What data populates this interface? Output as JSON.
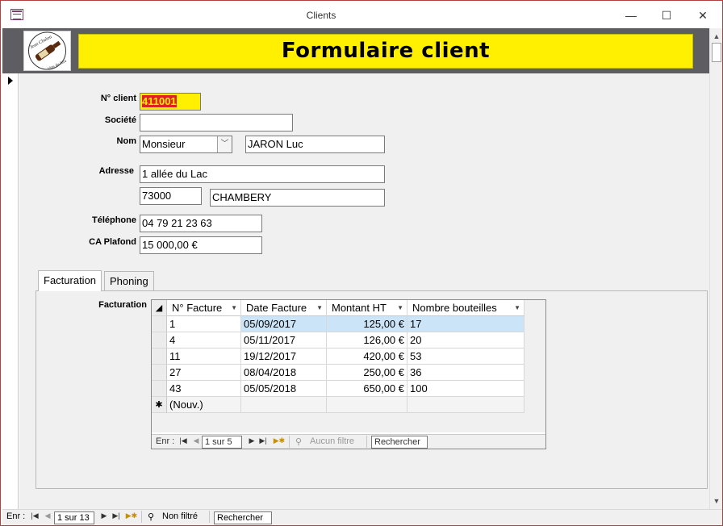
{
  "window": {
    "title": "Clients",
    "controls": {
      "minimize": "—",
      "maximize": "☐",
      "close": "✕"
    }
  },
  "header": {
    "logo": {
      "text_top": "Jean Chalon",
      "text_bottom": "Vins du Jura"
    },
    "banner_title": "Formulaire client",
    "banner_color": "#ffef00",
    "strip_color": "#5e5e62"
  },
  "form": {
    "client_no": {
      "label": "N° client",
      "value": "411001"
    },
    "societe": {
      "label": "Société",
      "value": ""
    },
    "nom": {
      "label": "Nom",
      "civilite": "Monsieur",
      "value": "JARON Luc"
    },
    "adresse": {
      "label": "Adresse",
      "line1": "1 allée du Lac",
      "cp": "73000",
      "ville": "CHAMBERY"
    },
    "telephone": {
      "label": "Téléphone",
      "value": "04 79 21 23 63"
    },
    "ca_plafond": {
      "label": "CA Plafond",
      "value": "15 000,00 €"
    }
  },
  "tabs": [
    {
      "label": "Facturation",
      "active": true
    },
    {
      "label": "Phoning",
      "active": false
    }
  ],
  "facturation": {
    "label": "Facturation",
    "columns": [
      "N° Facture",
      "Date Facture",
      "Montant HT",
      "Nombre bouteilles"
    ],
    "rows": [
      [
        "1",
        "05/09/2017",
        "125,00 €",
        "17"
      ],
      [
        "4",
        "05/11/2017",
        "126,00 €",
        "20"
      ],
      [
        "11",
        "19/12/2017",
        "420,00 €",
        "53"
      ],
      [
        "27",
        "08/04/2018",
        "250,00 €",
        "36"
      ],
      [
        "43",
        "05/05/2018",
        "650,00 €",
        "100"
      ]
    ],
    "new_row_marker": "✱",
    "new_row_label": "(Nouv.)",
    "nav": {
      "label": "Enr :",
      "position": "1 sur 5",
      "filter": "Aucun filtre",
      "search": "Rechercher"
    }
  },
  "record_nav": {
    "label": "Enr :",
    "position": "1 sur 13",
    "filter": "Non filtré",
    "search": "Rechercher"
  },
  "nav_glyphs": {
    "first": "|◀",
    "prev": "◀",
    "next": "▶",
    "last": "▶|",
    "new": "▶✱",
    "filter_icon": "⚲"
  }
}
